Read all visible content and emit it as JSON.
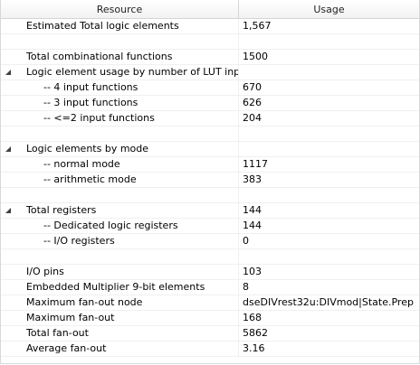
{
  "header": {
    "resource_label": "Resource",
    "usage_label": "Usage"
  },
  "rows": [
    {
      "resource": "Estimated Total logic elements",
      "usage": "1,567",
      "level": 0,
      "expander": false
    },
    {
      "resource": "",
      "usage": "",
      "level": 0,
      "expander": false
    },
    {
      "resource": "Total combinational functions",
      "usage": "1500",
      "level": 0,
      "expander": false
    },
    {
      "resource": "Logic element usage by number of LUT inputs",
      "usage": "",
      "level": 0,
      "expander": true
    },
    {
      "resource": "-- 4 input functions",
      "usage": "670",
      "level": 1,
      "expander": false
    },
    {
      "resource": "-- 3 input functions",
      "usage": "626",
      "level": 1,
      "expander": false
    },
    {
      "resource": "-- <=2 input functions",
      "usage": "204",
      "level": 1,
      "expander": false
    },
    {
      "resource": "",
      "usage": "",
      "level": 0,
      "expander": false
    },
    {
      "resource": "Logic elements by mode",
      "usage": "",
      "level": 0,
      "expander": true
    },
    {
      "resource": "-- normal mode",
      "usage": "1117",
      "level": 1,
      "expander": false
    },
    {
      "resource": "-- arithmetic mode",
      "usage": "383",
      "level": 1,
      "expander": false
    },
    {
      "resource": "",
      "usage": "",
      "level": 0,
      "expander": false
    },
    {
      "resource": "Total registers",
      "usage": "144",
      "level": 0,
      "expander": true
    },
    {
      "resource": "-- Dedicated logic registers",
      "usage": "144",
      "level": 1,
      "expander": false
    },
    {
      "resource": "-- I/O registers",
      "usage": "0",
      "level": 1,
      "expander": false
    },
    {
      "resource": "",
      "usage": "",
      "level": 0,
      "expander": false
    },
    {
      "resource": "I/O pins",
      "usage": "103",
      "level": 0,
      "expander": false
    },
    {
      "resource": "Embedded Multiplier 9-bit elements",
      "usage": "8",
      "level": 0,
      "expander": false
    },
    {
      "resource": "Maximum fan-out node",
      "usage": "dseDIVrest32u:DIVmod|State.Prep",
      "level": 0,
      "expander": false
    },
    {
      "resource": "Maximum fan-out",
      "usage": "168",
      "level": 0,
      "expander": false
    },
    {
      "resource": "Total fan-out",
      "usage": "5862",
      "level": 0,
      "expander": false
    },
    {
      "resource": "Average fan-out",
      "usage": "3.16",
      "level": 0,
      "expander": false
    }
  ]
}
